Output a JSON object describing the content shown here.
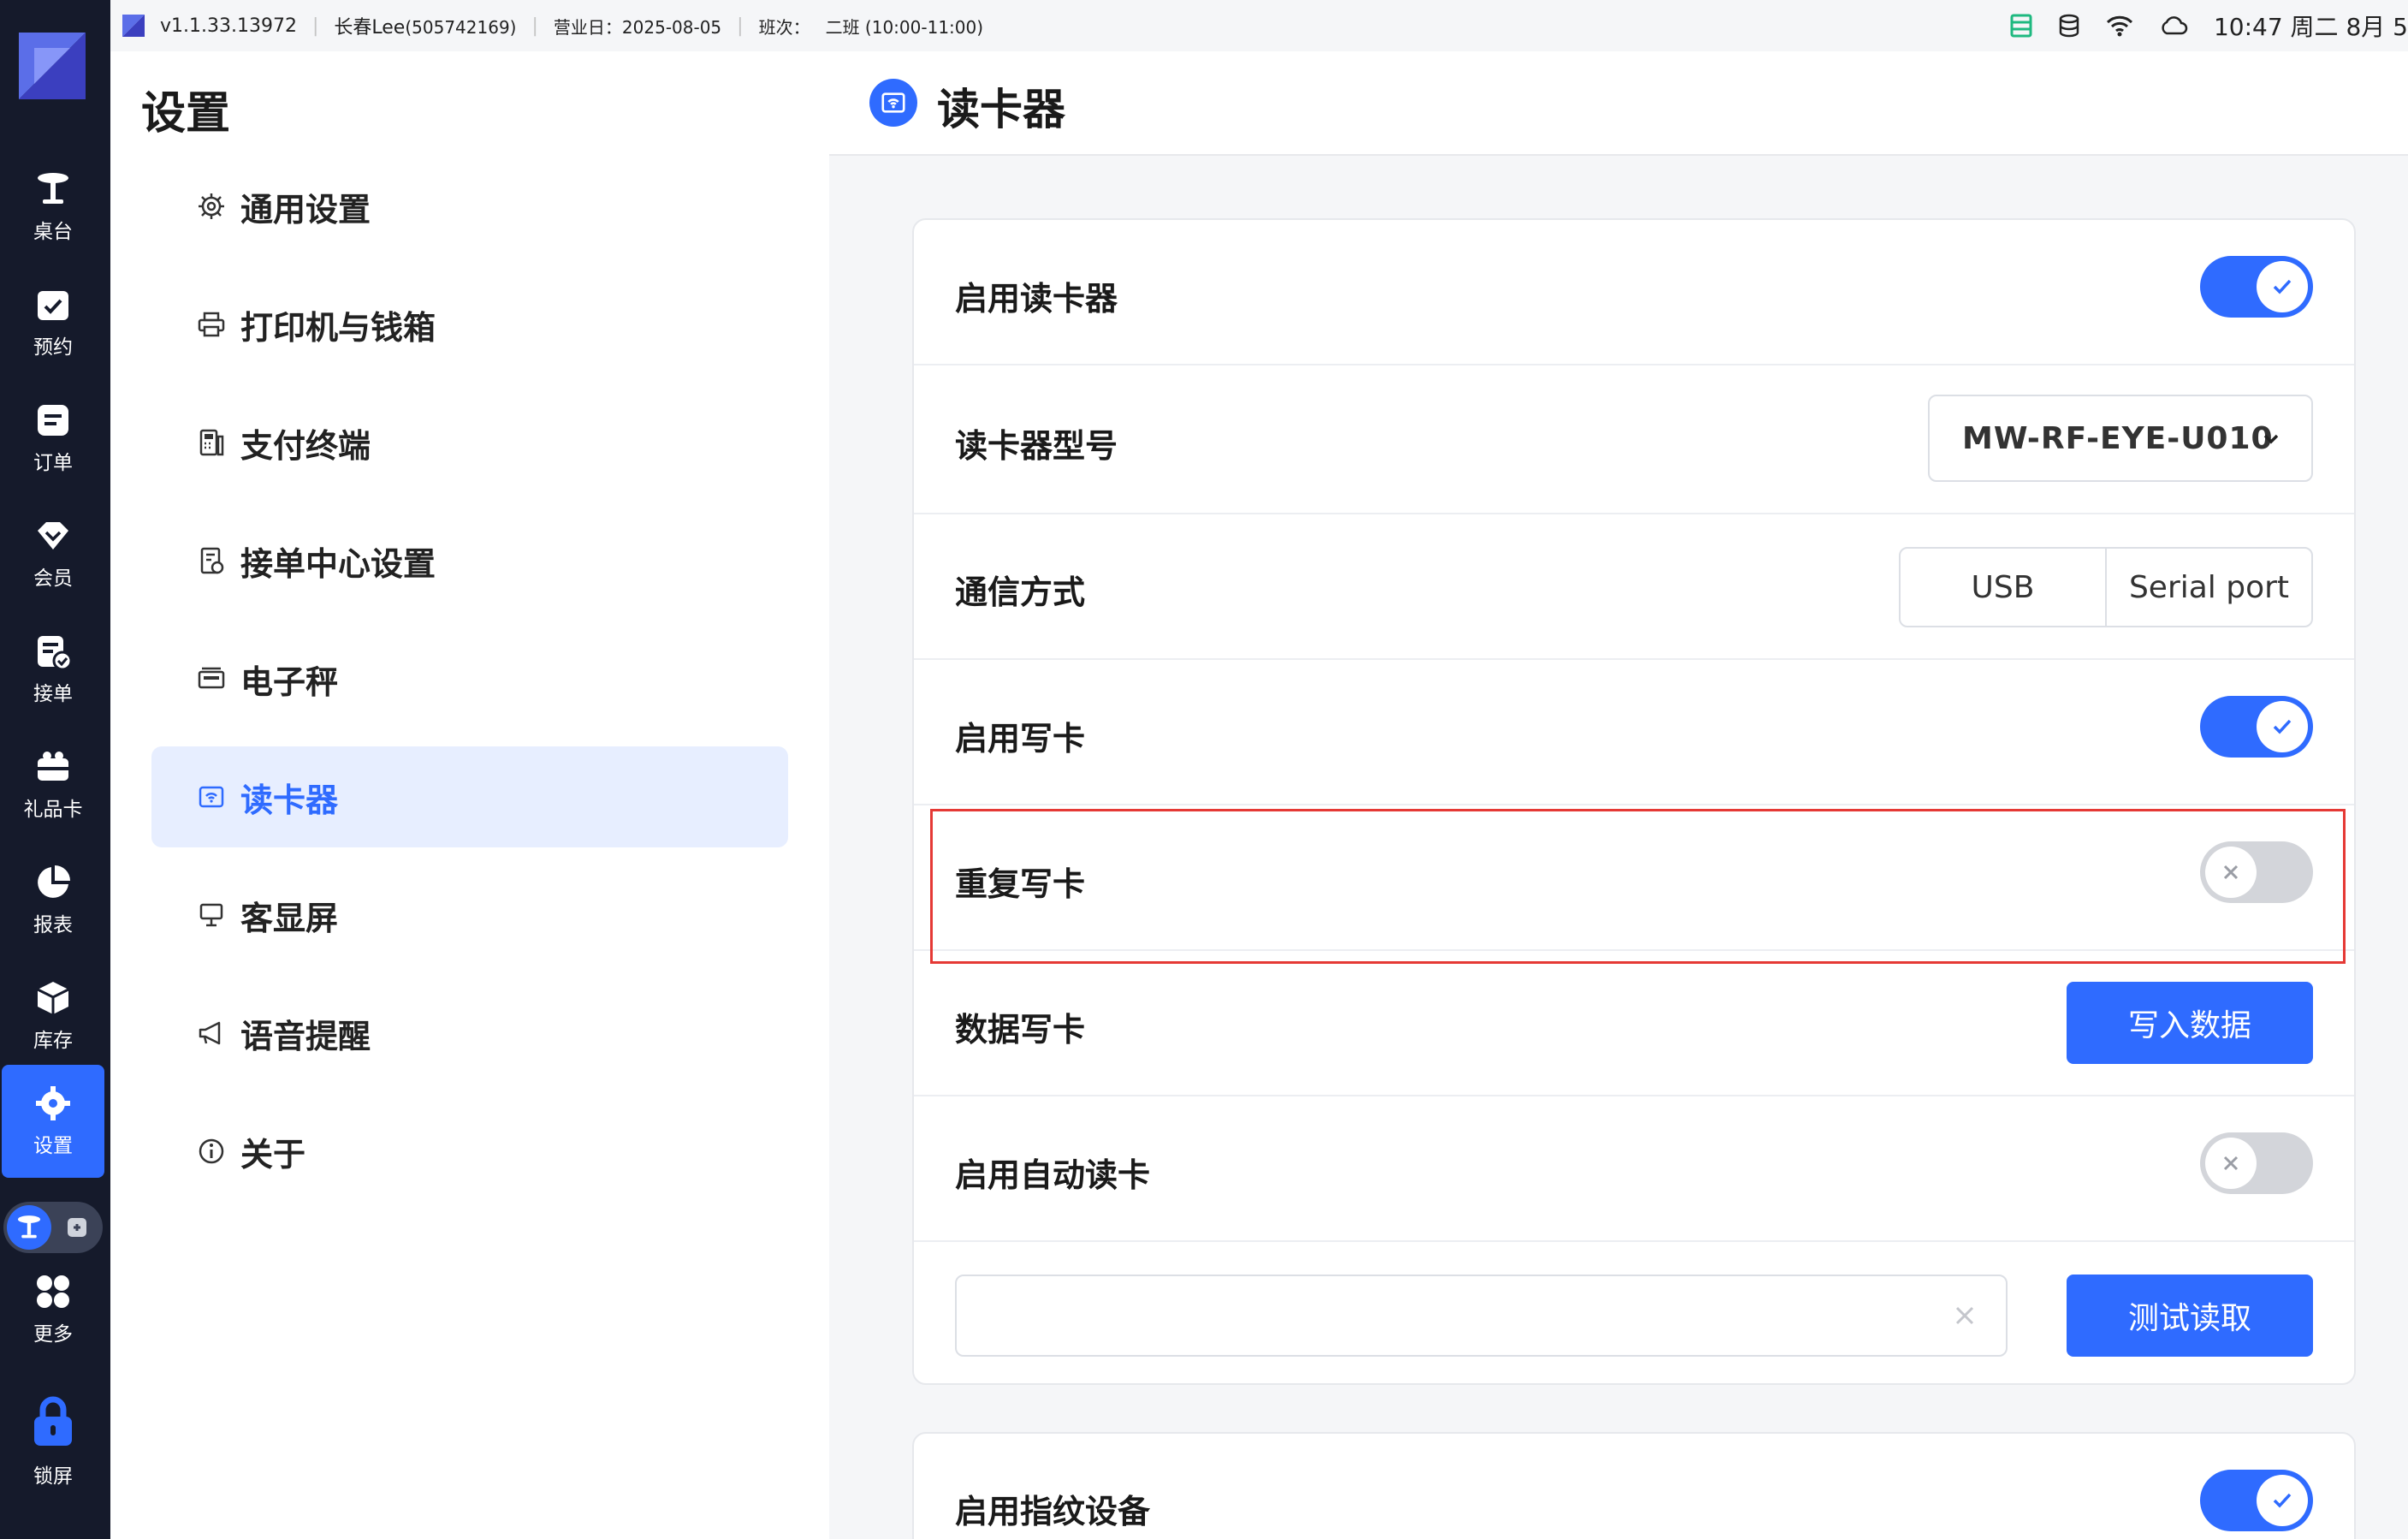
{
  "status_bar": {
    "version": "v1.1.33.13972",
    "user": "长春Lee",
    "user_id": "(505742169)",
    "business_day": "营业日：2025-08-05",
    "shift_label": "班次：",
    "shift_value": "二班 (10:00-11:00)",
    "clock": "10:47 周二 8月 5"
  },
  "rail": {
    "items": [
      {
        "label": "桌台",
        "icon": "table-icon"
      },
      {
        "label": "预约",
        "icon": "reservation-icon"
      },
      {
        "label": "订单",
        "icon": "order-icon"
      },
      {
        "label": "会员",
        "icon": "member-icon"
      },
      {
        "label": "接单",
        "icon": "accept-order-icon"
      },
      {
        "label": "礼品卡",
        "icon": "gift-card-icon"
      },
      {
        "label": "报表",
        "icon": "report-icon"
      },
      {
        "label": "库存",
        "icon": "inventory-icon"
      },
      {
        "label": "设置",
        "icon": "gear-icon"
      },
      {
        "label": "更多",
        "icon": "more-icon"
      },
      {
        "label": "锁屏",
        "icon": "lock-icon"
      }
    ],
    "active": "设置"
  },
  "settings_nav": {
    "title": "设置",
    "items": [
      {
        "label": "通用设置",
        "icon": "gear-icon"
      },
      {
        "label": "打印机与钱箱",
        "icon": "printer-icon"
      },
      {
        "label": "支付终端",
        "icon": "payment-terminal-icon"
      },
      {
        "label": "接单中心设置",
        "icon": "order-center-icon"
      },
      {
        "label": "电子秤",
        "icon": "scale-icon"
      },
      {
        "label": "读卡器",
        "icon": "card-reader-icon"
      },
      {
        "label": "客显屏",
        "icon": "customer-display-icon"
      },
      {
        "label": "语音提醒",
        "icon": "megaphone-icon"
      },
      {
        "label": "关于",
        "icon": "info-icon"
      }
    ],
    "active": "读卡器"
  },
  "panel": {
    "title": "读卡器",
    "rows": {
      "enable_reader": {
        "label": "启用读卡器",
        "on": true
      },
      "reader_model": {
        "label": "读卡器型号",
        "value": "MW-RF-EYE-U010"
      },
      "comm_mode": {
        "label": "通信方式",
        "options": [
          "USB",
          "Serial port"
        ]
      },
      "enable_write": {
        "label": "启用写卡",
        "on": true
      },
      "repeat_write": {
        "label": "重复写卡",
        "on": false
      },
      "data_write": {
        "label": "数据写卡",
        "button": "写入数据"
      },
      "auto_read": {
        "label": "启用自动读卡",
        "on": false
      },
      "test_read": {
        "input_value": "",
        "button": "测试读取"
      }
    },
    "card2": {
      "enable_fingerprint": {
        "label": "启用指纹设备",
        "on": true
      }
    }
  },
  "colors": {
    "accent": "#2f6bff",
    "rail_bg": "#151a2b",
    "switch_off": "#d3d5da",
    "highlight": "#e53935"
  }
}
